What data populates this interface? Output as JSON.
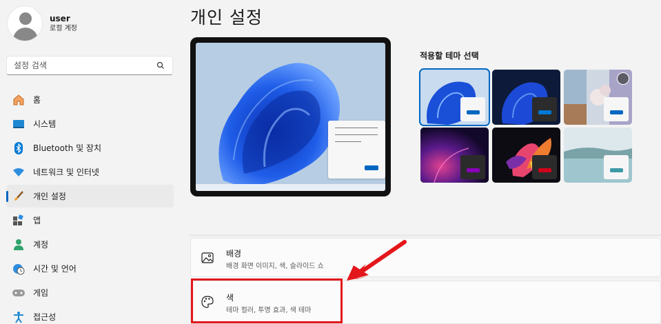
{
  "user": {
    "name": "user",
    "account_type": "로컬 계정"
  },
  "search": {
    "placeholder": "설정 검색"
  },
  "nav": {
    "items": [
      {
        "label": "홈",
        "icon": "home-icon"
      },
      {
        "label": "시스템",
        "icon": "system-icon"
      },
      {
        "label": "Bluetooth 및 장치",
        "icon": "bluetooth-icon"
      },
      {
        "label": "네트워크 및 인터넷",
        "icon": "network-icon"
      },
      {
        "label": "개인 설정",
        "icon": "brush-icon",
        "active": true
      },
      {
        "label": "앱",
        "icon": "apps-icon"
      },
      {
        "label": "계정",
        "icon": "account-icon"
      },
      {
        "label": "시간 및 언어",
        "icon": "time-language-icon"
      },
      {
        "label": "게임",
        "icon": "gaming-icon"
      },
      {
        "label": "접근성",
        "icon": "accessibility-icon"
      }
    ]
  },
  "page": {
    "title": "개인 설정"
  },
  "themes": {
    "label": "적용할 테마 선택",
    "items": [
      {
        "name": "windows-light",
        "selected": true,
        "accent": "#0067c0"
      },
      {
        "name": "windows-dark",
        "accent": "#0078d4"
      },
      {
        "name": "windows-spotlight",
        "accent": "#0067c0"
      },
      {
        "name": "glow",
        "accent": "#8a00b8"
      },
      {
        "name": "captured-motion",
        "accent": "#d0021b"
      },
      {
        "name": "flow",
        "accent": "#3f9aa8"
      }
    ]
  },
  "cards": [
    {
      "title": "배경",
      "description": "배경 화면 이미지, 색, 슬라이드 쇼",
      "icon": "picture-icon"
    },
    {
      "title": "색",
      "description": "테마 컬러, 투명 효과, 색 테마",
      "icon": "palette-icon"
    }
  ],
  "colors": {
    "accent": "#0067c0",
    "highlight": "#e3161b"
  }
}
